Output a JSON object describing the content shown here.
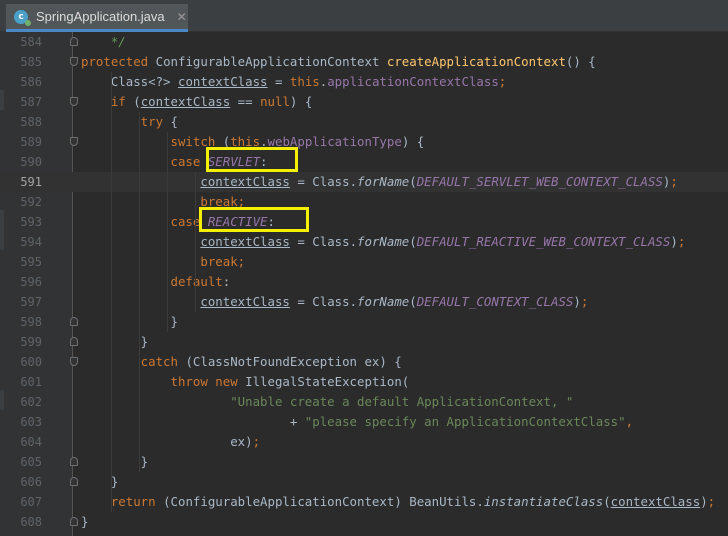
{
  "tab": {
    "label": "SpringApplication.java",
    "icon": "java-class-icon",
    "icon_letter": "c",
    "close": "✕"
  },
  "current_line": "591",
  "colors": {
    "keyword": "#cc7832",
    "method": "#ffc66d",
    "field": "#9876aa",
    "string": "#6a8759",
    "comment": "#629755",
    "highlight": "#f4f000"
  },
  "lines": [
    {
      "n": "584",
      "segs": [
        [
          "cmt",
          "    */"
        ]
      ]
    },
    {
      "n": "585",
      "segs": [
        [
          "kw",
          "protected "
        ],
        [
          "",
          "ConfigurableApplicationContext "
        ],
        [
          "fn",
          "createApplicationContext"
        ],
        [
          "",
          "() {"
        ]
      ]
    },
    {
      "n": "586",
      "segs": [
        [
          "",
          "    Class<?> "
        ],
        [
          "ul",
          "contextClass"
        ],
        [
          "",
          " = "
        ],
        [
          "kw",
          "this"
        ],
        [
          "",
          "."
        ],
        [
          "fld",
          "applicationContextClass"
        ],
        [
          "kw",
          ";"
        ]
      ]
    },
    {
      "n": "587",
      "segs": [
        [
          "kw",
          "    if "
        ],
        [
          "",
          "("
        ],
        [
          "ul",
          "contextClass"
        ],
        [
          "",
          " == "
        ],
        [
          "kw",
          "null"
        ],
        [
          "",
          ") {"
        ]
      ]
    },
    {
      "n": "588",
      "segs": [
        [
          "kw",
          "        try "
        ],
        [
          "",
          "{"
        ]
      ]
    },
    {
      "n": "589",
      "segs": [
        [
          "kw",
          "            switch "
        ],
        [
          "",
          "("
        ],
        [
          "kw",
          "this"
        ],
        [
          "",
          "."
        ],
        [
          "fld",
          "webApplicationType"
        ],
        [
          "",
          ") {"
        ]
      ]
    },
    {
      "n": "590",
      "segs": [
        [
          "kw",
          "            case "
        ],
        [
          "cnst",
          "SERVLET"
        ],
        [
          "",
          ":"
        ]
      ]
    },
    {
      "n": "591",
      "segs": [
        [
          "",
          "                "
        ],
        [
          "ul",
          "contextClass"
        ],
        [
          "",
          " = Class."
        ],
        [
          "st",
          "forName"
        ],
        [
          "",
          "("
        ],
        [
          "cnst",
          "DEFAULT_SERVLET_WEB_CONTEXT_CLASS"
        ],
        [
          "",
          ")"
        ],
        [
          "kw",
          ";"
        ]
      ]
    },
    {
      "n": "592",
      "segs": [
        [
          "kw",
          "                break;"
        ]
      ]
    },
    {
      "n": "593",
      "segs": [
        [
          "kw",
          "            case "
        ],
        [
          "cnst",
          "REACTIVE"
        ],
        [
          "",
          ":"
        ]
      ]
    },
    {
      "n": "594",
      "segs": [
        [
          "",
          "                "
        ],
        [
          "ul",
          "contextClass"
        ],
        [
          "",
          " = Class."
        ],
        [
          "st",
          "forName"
        ],
        [
          "",
          "("
        ],
        [
          "cnst",
          "DEFAULT_REACTIVE_WEB_CONTEXT_CLASS"
        ],
        [
          "",
          ")"
        ],
        [
          "kw",
          ";"
        ]
      ]
    },
    {
      "n": "595",
      "segs": [
        [
          "kw",
          "                break;"
        ]
      ]
    },
    {
      "n": "596",
      "segs": [
        [
          "kw",
          "            default"
        ],
        [
          "",
          ":"
        ]
      ]
    },
    {
      "n": "597",
      "segs": [
        [
          "",
          "                "
        ],
        [
          "ul",
          "contextClass"
        ],
        [
          "",
          " = Class."
        ],
        [
          "st",
          "forName"
        ],
        [
          "",
          "("
        ],
        [
          "cnst",
          "DEFAULT_CONTEXT_CLASS"
        ],
        [
          "",
          ")"
        ],
        [
          "kw",
          ";"
        ]
      ]
    },
    {
      "n": "598",
      "segs": [
        [
          "",
          "            }"
        ]
      ]
    },
    {
      "n": "599",
      "segs": [
        [
          "",
          "        }"
        ]
      ]
    },
    {
      "n": "600",
      "segs": [
        [
          "kw",
          "        catch "
        ],
        [
          "",
          "(ClassNotFoundException ex) {"
        ]
      ]
    },
    {
      "n": "601",
      "segs": [
        [
          "kw",
          "            throw new "
        ],
        [
          "",
          "IllegalStateException("
        ]
      ]
    },
    {
      "n": "602",
      "segs": [
        [
          "str",
          "                    \"Unable create a default ApplicationContext, \""
        ]
      ]
    },
    {
      "n": "603",
      "segs": [
        [
          "",
          "                            + "
        ],
        [
          "str",
          "\"please specify an ApplicationContextClass\""
        ],
        [
          "kw",
          ","
        ]
      ]
    },
    {
      "n": "604",
      "segs": [
        [
          "",
          "                    ex)"
        ],
        [
          "kw",
          ";"
        ]
      ]
    },
    {
      "n": "605",
      "segs": [
        [
          "",
          "        }"
        ]
      ]
    },
    {
      "n": "606",
      "segs": [
        [
          "",
          "    }"
        ]
      ]
    },
    {
      "n": "607",
      "segs": [
        [
          "kw",
          "    return "
        ],
        [
          "",
          "(ConfigurableApplicationContext) BeanUtils."
        ],
        [
          "st",
          "instantiateClass"
        ],
        [
          "",
          "("
        ],
        [
          "ul",
          "contextClass"
        ],
        [
          "",
          ")"
        ],
        [
          "kw",
          ";"
        ]
      ]
    },
    {
      "n": "608",
      "segs": [
        [
          "",
          "}"
        ]
      ]
    }
  ]
}
